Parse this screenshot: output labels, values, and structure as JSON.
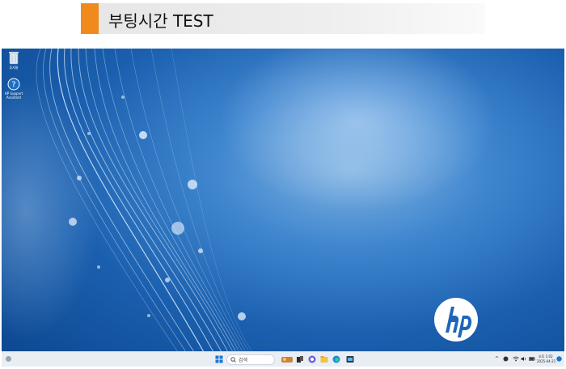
{
  "banner": {
    "title": "부팅시간 TEST",
    "accent_color": "#f08a1c"
  },
  "desktop": {
    "icons": [
      {
        "label": "휴지통",
        "icon": "recycle-bin-icon"
      },
      {
        "label": "HP Support Assistant",
        "icon": "help-question-icon"
      }
    ],
    "brand_logo": "hp-logo"
  },
  "taskbar": {
    "search_placeholder": "검색",
    "pinned_icons": [
      "start-icon",
      "search-icon",
      "widgets-icon",
      "task-view-icon",
      "chat-icon",
      "edge-icon",
      "file-explorer-icon",
      "store-icon"
    ],
    "tray": {
      "clock_time": "오후 1:02",
      "clock_date": "2025-04-21"
    }
  }
}
